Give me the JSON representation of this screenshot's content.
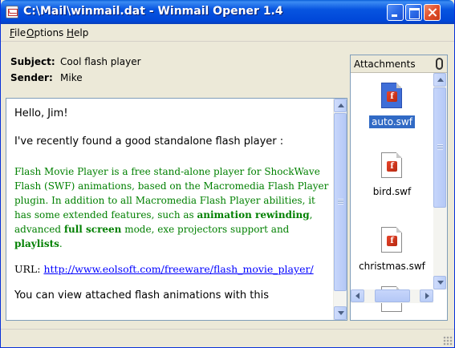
{
  "window": {
    "title": "C:\\Mail\\winmail.dat - Winmail Opener 1.4"
  },
  "menu": {
    "file_u": "F",
    "file_rest": "ile",
    "options_u": "O",
    "options_rest": "ptions",
    "help_u": "H",
    "help_rest": "elp"
  },
  "header": {
    "subject_label": "Subject:",
    "subject_value": "Cool flash player",
    "sender_label": "Sender:",
    "sender_value": "Mike"
  },
  "message": {
    "greeting": "Hello, Jim!",
    "intro": "I've recently found a good standalone flash player :",
    "desc_1": "Flash Movie Player is a free stand-alone player for ShockWave Flash (SWF) animations, based on the Macromedia Flash Player plugin. In addition to all Macromedia Flash Player abilities, it has some extended features, such as ",
    "desc_bold_1": "animation rewinding",
    "desc_2": ", advanced ",
    "desc_bold_2": "full screen",
    "desc_3": " mode, exe projectors support and ",
    "desc_bold_3": "playlists",
    "desc_4": ".",
    "url_label": "URL: ",
    "url": "http://www.eolsoft.com/freeware/flash_movie_player/",
    "closing": "You can view attached flash animations with this"
  },
  "attachments": {
    "title": "Attachments",
    "items": [
      {
        "name": "auto.swf",
        "selected": true
      },
      {
        "name": "bird.swf",
        "selected": false
      },
      {
        "name": "christmas.swf",
        "selected": false
      }
    ]
  },
  "colors": {
    "titlebar": "#0054e3",
    "green_text": "#008000",
    "link": "#0000ff",
    "selection": "#316ac5"
  }
}
